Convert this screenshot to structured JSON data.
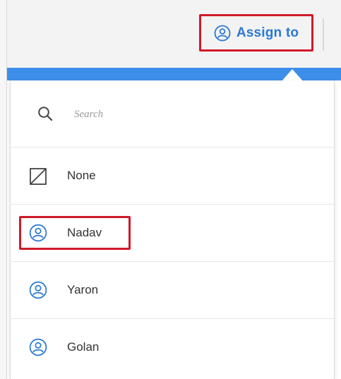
{
  "toolbar": {
    "assign_label": "Assign to"
  },
  "search": {
    "placeholder": "Search"
  },
  "options": [
    {
      "label": "None",
      "icon": "none-icon"
    },
    {
      "label": "Nadav",
      "icon": "user-icon"
    },
    {
      "label": "Yaron",
      "icon": "user-icon"
    },
    {
      "label": "Golan",
      "icon": "user-icon"
    }
  ],
  "colors": {
    "accent": "#2a78d6",
    "band": "#3d8eea",
    "highlight": "#d0192a"
  }
}
